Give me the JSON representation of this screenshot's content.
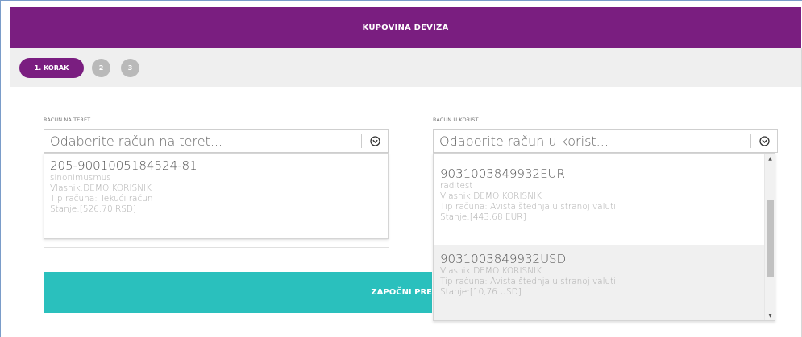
{
  "header": {
    "title": "KUPOVINA DEVIZA"
  },
  "steps": {
    "active_label": "1. KORAK",
    "step2": "2",
    "step3": "3"
  },
  "debit": {
    "label": "RAČUN NA TERET",
    "placeholder": "Odaberite račun na teret...",
    "options": [
      {
        "number": "205-9001005184524-81",
        "alias": "sinonimusmus",
        "owner_label": "Vlasnik:",
        "owner": "DEMO KORISNIK",
        "type_label": "Tip računa:",
        "type": "Tekući račun",
        "balance": "Stanje:[526,70 RSD]"
      }
    ]
  },
  "credit": {
    "label": "RAČUN U KORIST",
    "placeholder": "Odaberite račun u korist...",
    "options": [
      {
        "number": "9031003849932EUR",
        "alias": "raditest",
        "owner_label": "Vlasnik:",
        "owner": "DEMO KORISNIK",
        "type_label": "Tip računa:",
        "type": "Avista štednja u stranoj valuti",
        "balance": "Stanje:[443,68 EUR]"
      },
      {
        "number": "9031003849932USD",
        "owner_label": "Vlasnik:",
        "owner": "DEMO KORISNIK",
        "type_label": "Tip računa:",
        "type": "Avista štednja u stranoj valuti",
        "balance": "Stanje:[10,76 USD]"
      }
    ]
  },
  "cta": {
    "label": "ZAPOČNI PRE"
  },
  "icons": {
    "select": "chevron-circle-down-icon",
    "scroll_up": "scroll-up-arrow-icon",
    "scroll_down": "scroll-down-arrow-icon"
  },
  "colors": {
    "brand": "#7a1e80",
    "accent": "#2ac0bd"
  }
}
